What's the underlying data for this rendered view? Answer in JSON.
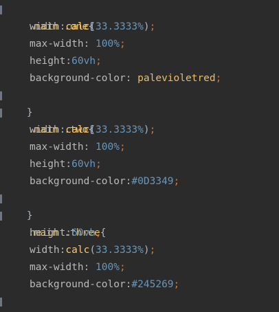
{
  "colors": {
    "background": "#2b2b2b",
    "selector": "#e8bf6a",
    "property": "#bababa",
    "function": "#ffc66d",
    "number": "#6897bb",
    "punctuation": "#cc7832",
    "text": "#a9b7c6"
  },
  "code": {
    "l1": {
      "sel": ".main .one",
      "brace": "{"
    },
    "l2": {
      "prop": "width",
      "colon": ":",
      "fn": "calc",
      "paren_open": "(",
      "num": "33.3333",
      "pct": "%",
      "paren_close": ")",
      "semi": ";"
    },
    "l3": {
      "prop": "max-width",
      "colon": ": ",
      "num": "100",
      "pct": "%",
      "semi": ";"
    },
    "l4": {
      "prop": "height",
      "colon": ":",
      "num": "60",
      "unit": "vh",
      "semi": ";"
    },
    "l5": {
      "prop": "background-color",
      "colon": ": ",
      "value": "palevioletred",
      "semi": ";"
    },
    "l6": {
      "brace": "}"
    },
    "l7": {
      "sel": ".main .two",
      "brace": "{"
    },
    "l8": {
      "prop": "width",
      "colon": ":",
      "fn": "calc",
      "paren_open": "(",
      "num": "33.3333",
      "pct": "%",
      "paren_close": ")",
      "semi": ";"
    },
    "l9": {
      "prop": "max-width",
      "colon": ": ",
      "num": "100",
      "pct": "%",
      "semi": ";"
    },
    "l10": {
      "prop": "height",
      "colon": ":",
      "num": "60",
      "unit": "vh",
      "semi": ";"
    },
    "l11": {
      "prop": "background-color",
      "colon": ":",
      "value": "#0D3349",
      "semi": ";"
    },
    "l12": {
      "brace": "}"
    },
    "l13": {
      "sel": ".main .three",
      "brace": "{"
    },
    "l14": {
      "prop": "height",
      "colon": ":",
      "num": "60",
      "unit": "vh",
      "semi": ";"
    },
    "l15": {
      "prop": "width",
      "colon": ":",
      "fn": "calc",
      "paren_open": "(",
      "num": "33.3333",
      "pct": "%",
      "paren_close": ")",
      "semi": ";"
    },
    "l16": {
      "prop": "max-width",
      "colon": ": ",
      "num": "100",
      "pct": "%",
      "semi": ";"
    },
    "l17": {
      "prop": "background-color",
      "colon": ":",
      "value": "#245269",
      "semi": ";"
    },
    "l18": {
      "brace": "}"
    }
  }
}
